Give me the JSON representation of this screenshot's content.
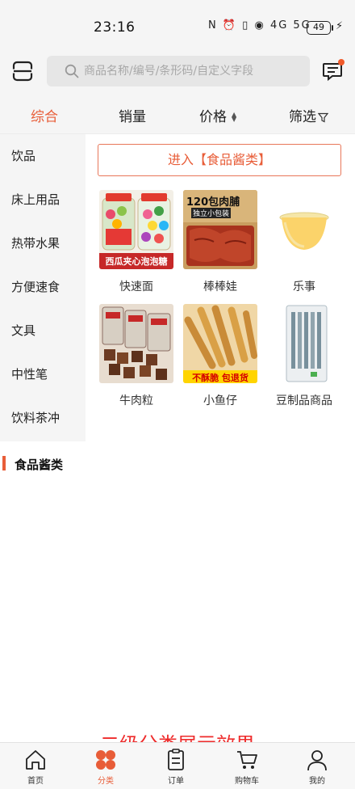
{
  "status_bar": {
    "time": "23:16",
    "glyphs": "N ⏰ ▯ ◉ 4G 5G",
    "battery": "49"
  },
  "header": {
    "search_placeholder": "商品名称/编号/条形码/自定义字段"
  },
  "sort_bar": {
    "tabs": [
      {
        "label": "综合",
        "active": true
      },
      {
        "label": "销量"
      },
      {
        "label": "价格"
      },
      {
        "label": "筛选"
      }
    ]
  },
  "sidebar": {
    "items": [
      {
        "label": "饮品"
      },
      {
        "label": "床上用品"
      },
      {
        "label": "热带水果"
      },
      {
        "label": "方便速食"
      },
      {
        "label": "文具"
      },
      {
        "label": "中性笔"
      },
      {
        "label": "饮料茶冲"
      }
    ]
  },
  "main": {
    "enter_button": "进入【食品酱类】",
    "products": [
      {
        "name": "快速面",
        "img_text": "西瓜夹心泡泡糖"
      },
      {
        "name": "棒棒娃",
        "img_text": "120包肉脯",
        "img_sub": "独立小包装"
      },
      {
        "name": "乐事"
      },
      {
        "name": "牛肉粒"
      },
      {
        "name": "小鱼仔",
        "img_text": "不酥脆 包退货"
      },
      {
        "name": "豆制品商品"
      }
    ]
  },
  "section": {
    "title": "食品酱类"
  },
  "caption": "二级分类展示效果",
  "bottom_nav": {
    "items": [
      {
        "label": "首页",
        "icon": "home-icon"
      },
      {
        "label": "分类",
        "icon": "category-icon",
        "active": true
      },
      {
        "label": "订单",
        "icon": "order-icon"
      },
      {
        "label": "购物车",
        "icon": "cart-icon"
      },
      {
        "label": "我的",
        "icon": "user-icon"
      }
    ]
  },
  "colors": {
    "accent": "#e85d38",
    "caption": "#ee2b2b",
    "sidebar_bg": "#f5f5f5"
  }
}
